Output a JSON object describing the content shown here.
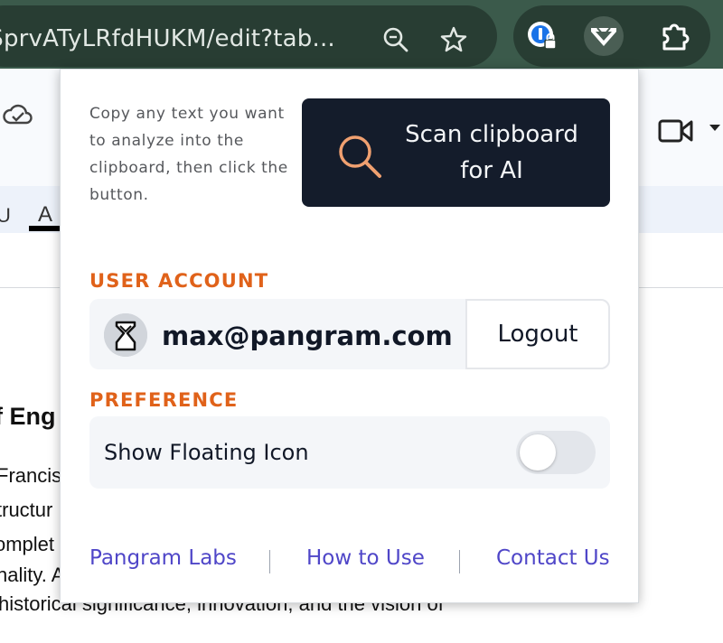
{
  "browser": {
    "url": "KSprvATyLRfdHUKM/edit?tab...",
    "extensions": [
      {
        "name": "password-manager-extension"
      },
      {
        "name": "pangram-extension",
        "active": true
      },
      {
        "name": "extensions-puzzle"
      }
    ]
  },
  "document": {
    "toolbar_letters": [
      "U",
      "A"
    ],
    "heading_fragment": "f Eng",
    "lines": [
      "Francis",
      "tructur",
      "omplet",
      "nality. A",
      "historical significance, innovation, and the vision of"
    ]
  },
  "popup": {
    "hint": "Copy any text you want to analyze into the clipboard, then click the button.",
    "scan_button": {
      "line1": "Scan clipboard",
      "line2": "for AI"
    },
    "account": {
      "section_title": "USER ACCOUNT",
      "email": "max@pangram.com",
      "logout_label": "Logout"
    },
    "preference": {
      "section_title": "PREFERENCE",
      "show_floating_icon_label": "Show Floating Icon",
      "show_floating_icon_enabled": false
    },
    "footer": {
      "links": [
        "Pangram Labs",
        "How to Use",
        "Contact Us"
      ]
    }
  },
  "colors": {
    "accent_orange": "#e0621a",
    "button_dark": "#141c2b",
    "link_purple": "#4f46c8"
  }
}
